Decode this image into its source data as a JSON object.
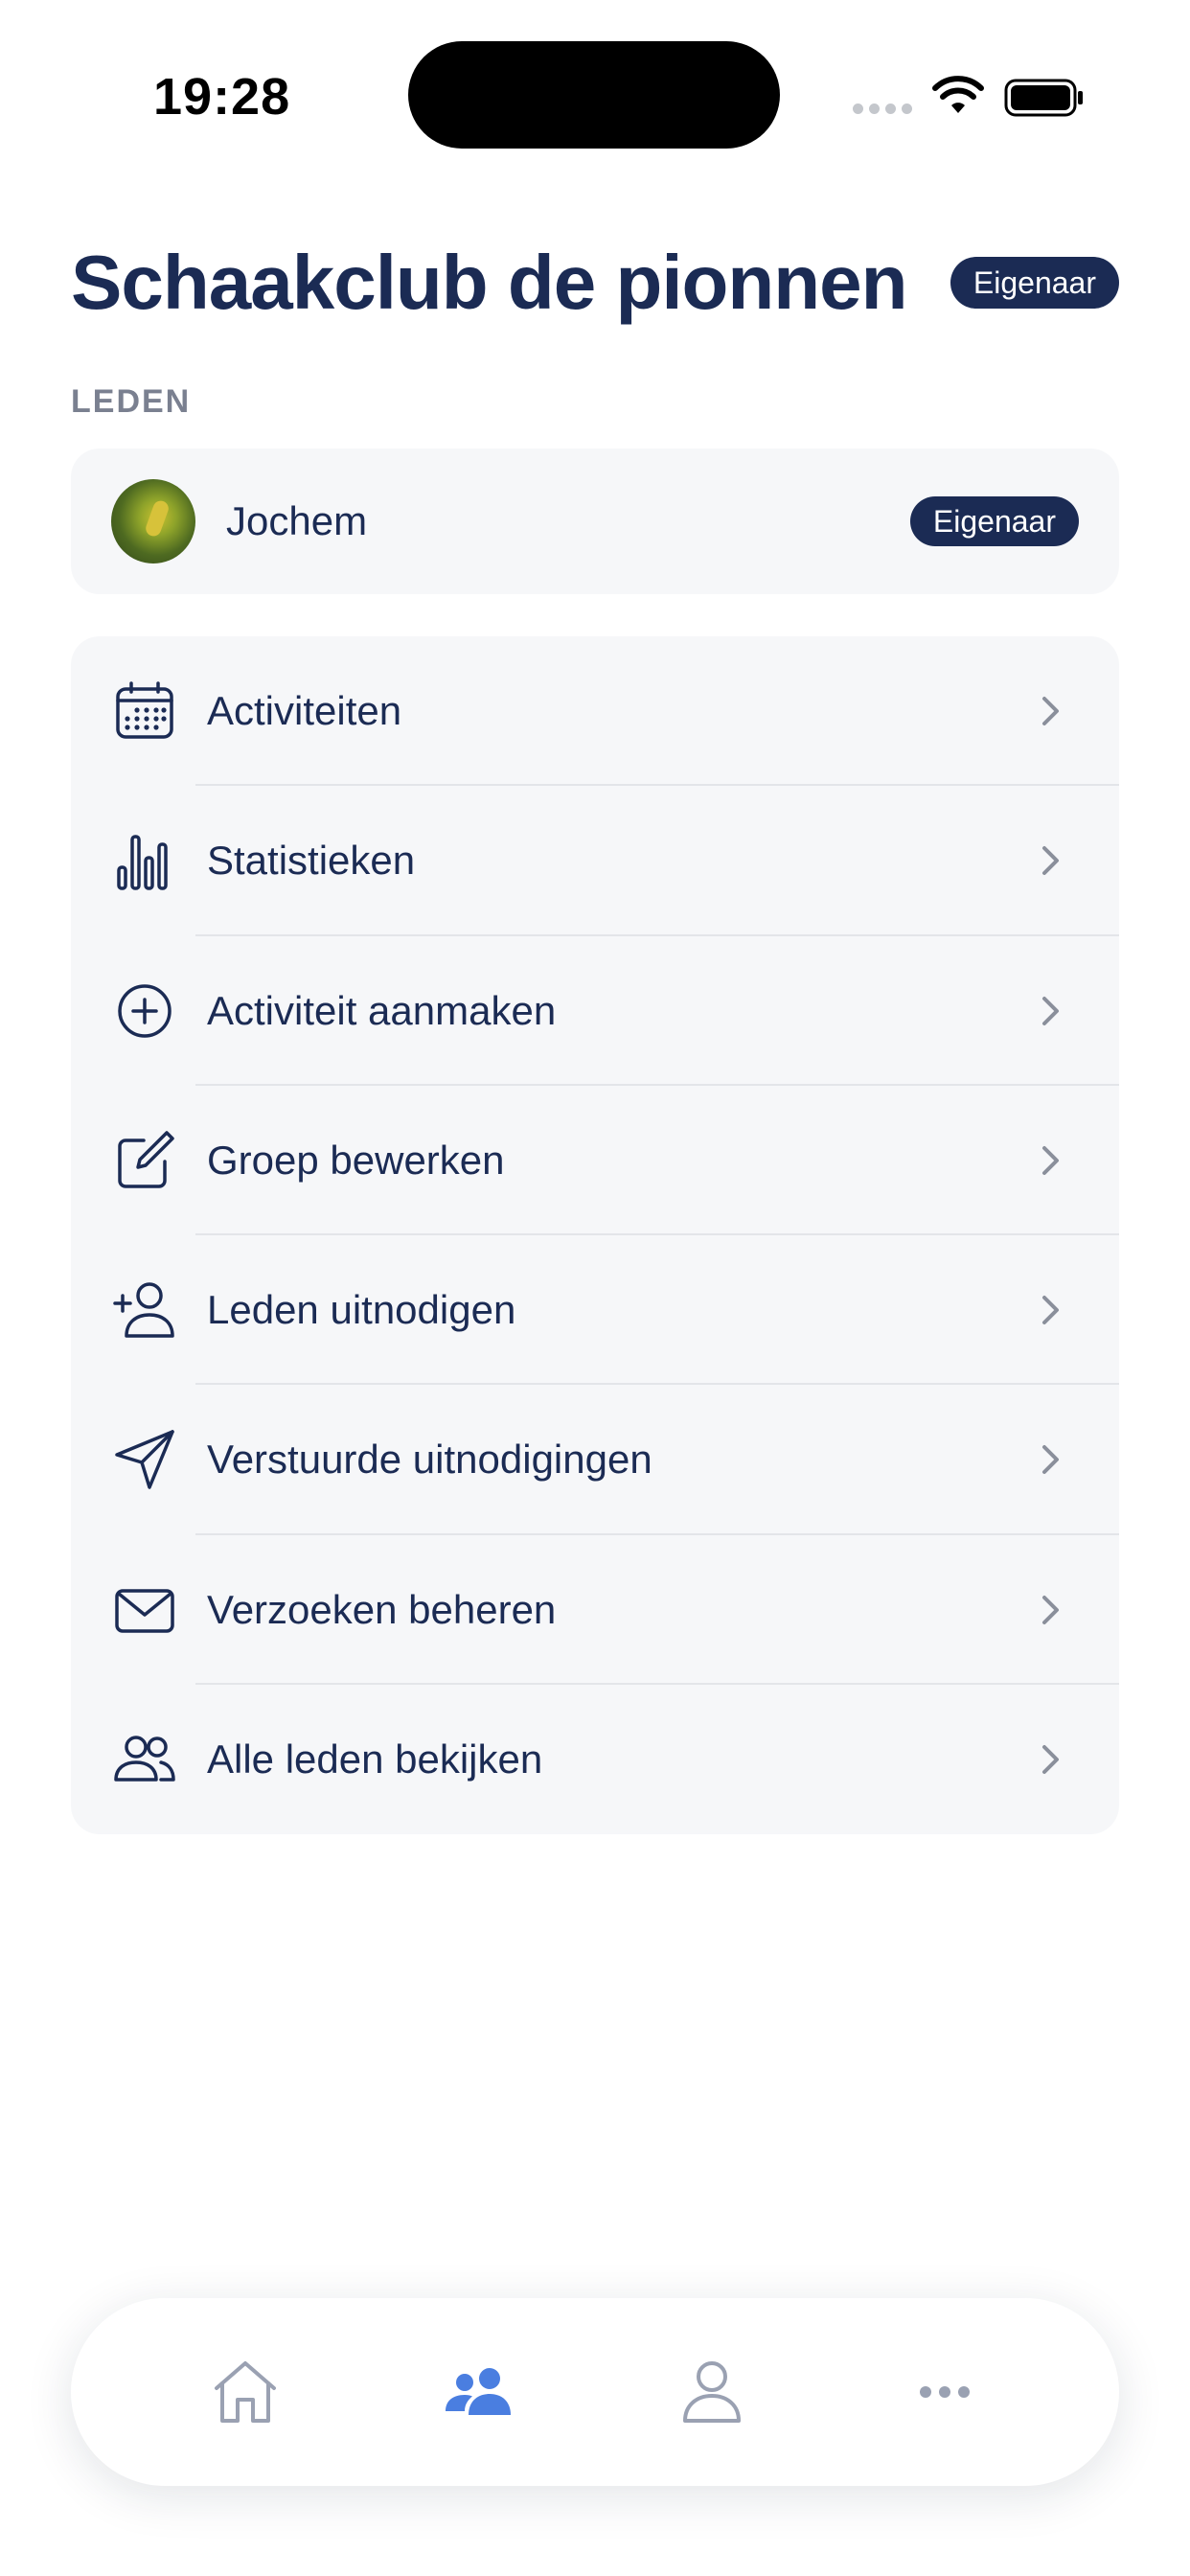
{
  "status_bar": {
    "time": "19:28"
  },
  "header": {
    "title": "Schaakclub de pionnen",
    "role_badge": "Eigenaar"
  },
  "members_section": {
    "label": "LEDEN",
    "members": [
      {
        "name": "Jochem",
        "role_badge": "Eigenaar"
      }
    ]
  },
  "menu": {
    "items": [
      {
        "label": "Activiteiten",
        "icon": "calendar-icon"
      },
      {
        "label": "Statistieken",
        "icon": "bar-chart-icon"
      },
      {
        "label": "Activiteit aanmaken",
        "icon": "plus-circle-icon"
      },
      {
        "label": "Groep bewerken",
        "icon": "edit-icon"
      },
      {
        "label": "Leden uitnodigen",
        "icon": "user-plus-icon"
      },
      {
        "label": "Verstuurde uitnodigingen",
        "icon": "send-icon"
      },
      {
        "label": "Verzoeken beheren",
        "icon": "mail-icon"
      },
      {
        "label": "Alle leden bekijken",
        "icon": "users-icon"
      }
    ]
  },
  "tab_bar": {
    "tabs": [
      {
        "icon": "home-icon",
        "active": false
      },
      {
        "icon": "group-icon",
        "active": true
      },
      {
        "icon": "profile-icon",
        "active": false
      },
      {
        "icon": "more-icon",
        "active": false
      }
    ]
  },
  "colors": {
    "primary": "#1b2b54",
    "active_tab": "#4a7ee0",
    "inactive_tab": "#9aa1b2",
    "card_bg": "#f6f7f9"
  }
}
